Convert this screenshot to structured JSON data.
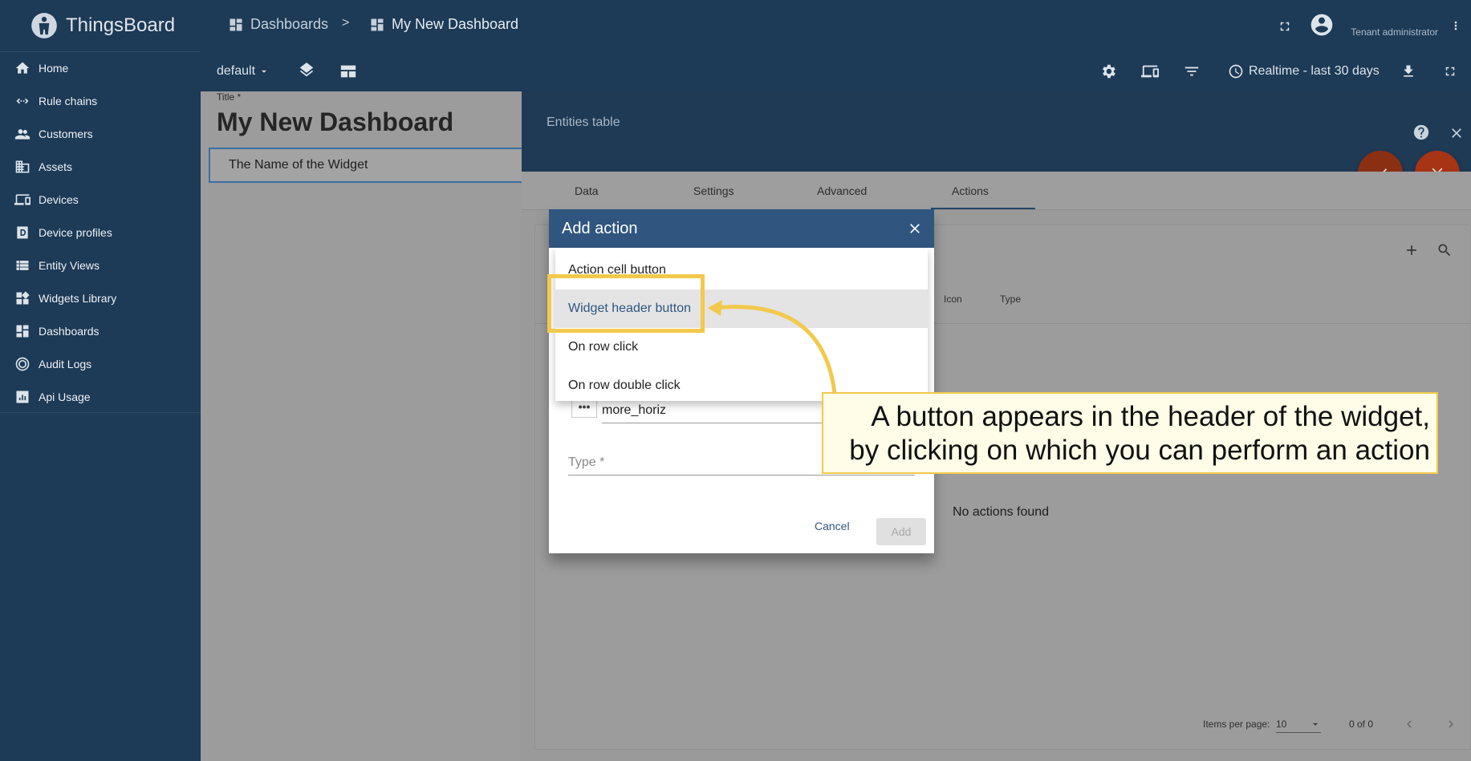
{
  "app": {
    "name": "ThingsBoard"
  },
  "sidebar": {
    "items": [
      {
        "label": "Home",
        "icon": "home-icon"
      },
      {
        "label": "Rule chains",
        "icon": "rule-chains-icon"
      },
      {
        "label": "Customers",
        "icon": "customers-icon"
      },
      {
        "label": "Assets",
        "icon": "assets-icon"
      },
      {
        "label": "Devices",
        "icon": "devices-icon"
      },
      {
        "label": "Device profiles",
        "icon": "device-profiles-icon"
      },
      {
        "label": "Entity Views",
        "icon": "entity-views-icon"
      },
      {
        "label": "Widgets Library",
        "icon": "widgets-library-icon"
      },
      {
        "label": "Dashboards",
        "icon": "dashboards-icon"
      },
      {
        "label": "Audit Logs",
        "icon": "audit-logs-icon"
      },
      {
        "label": "Api Usage",
        "icon": "api-usage-icon"
      }
    ]
  },
  "header": {
    "breadcrumb": [
      "Dashboards",
      "My New Dashboard"
    ],
    "breadcrumb_separator": ">",
    "user_role": "Tenant administrator"
  },
  "toolbar": {
    "state": "default",
    "timewindow": "Realtime - last 30 days"
  },
  "dashboard": {
    "title_label": "Title *",
    "title": "My New Dashboard",
    "widget_name": "The Name of the Widget"
  },
  "editor": {
    "widget_type": "Entities table",
    "tabs": [
      "Data",
      "Settings",
      "Advanced",
      "Actions"
    ],
    "active_tab": "Actions",
    "columns": [
      "Icon",
      "Type"
    ],
    "empty_text": "No actions found",
    "paginator": {
      "items_per_page_label": "Items per page:",
      "items_per_page": "10",
      "range": "0 of 0"
    }
  },
  "dialog": {
    "title": "Add action",
    "icon_value": "more_horiz",
    "type_label": "Type *",
    "cancel_label": "Cancel",
    "add_label": "Add"
  },
  "dropdown": {
    "options": [
      "Action cell button",
      "Widget header button",
      "On row click",
      "On row double click"
    ],
    "highlighted": "Widget header button"
  },
  "annotation": {
    "text_line1": "A button appears in the header of the widget,",
    "text_line2": "by clicking on which you can perform an action",
    "highlight_color": "#f2c94c"
  },
  "colors": {
    "primary": "#305680",
    "sidebar_bg": "#1d3a56",
    "fab_accent": "#a63415"
  }
}
